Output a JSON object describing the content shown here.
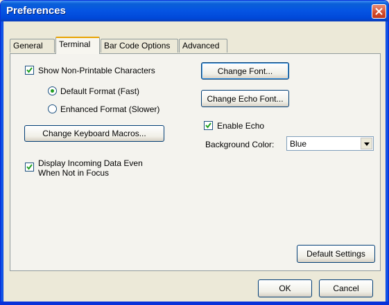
{
  "window": {
    "title": "Preferences"
  },
  "tabs": [
    "General",
    "Terminal",
    "Bar Code Options",
    "Advanced"
  ],
  "active_tab": "Terminal",
  "terminal": {
    "show_nonprintable": {
      "label": "Show Non-Printable Characters",
      "checked": true
    },
    "format_default": {
      "label": "Default Format (Fast)",
      "selected": true
    },
    "format_enhanced": {
      "label": "Enhanced Format (Slower)",
      "selected": false
    },
    "keyboard_macros_button": "Change Keyboard Macros...",
    "display_incoming": {
      "label_line1": "Display Incoming Data Even",
      "label_line2": "When Not in Focus",
      "checked": true
    },
    "change_font_button": "Change Font...",
    "change_echo_font_button": "Change Echo Font...",
    "enable_echo": {
      "label": "Enable Echo",
      "checked": true
    },
    "background_color": {
      "label": "Background Color:",
      "value": "Blue"
    },
    "default_settings_button": "Default Settings"
  },
  "footer": {
    "ok_label": "OK",
    "cancel_label": "Cancel"
  },
  "colors": {
    "title_bar": "#0554e3",
    "close_button": "#d34a2a",
    "active_tab_highlight": "#e8a200"
  },
  "icons": {
    "close": "close-icon",
    "checkmark": "checkmark-icon",
    "dropdown": "chevron-down-icon"
  }
}
